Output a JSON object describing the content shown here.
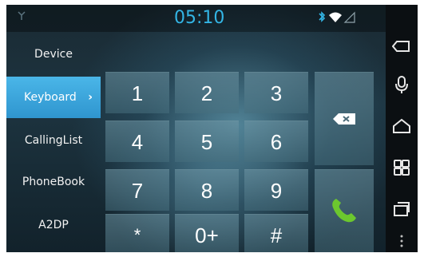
{
  "status_bar": {
    "time": "05:10",
    "icons": [
      "usb-debug-icon",
      "bluetooth-icon",
      "wifi-icon",
      "signal-icon"
    ]
  },
  "menu": {
    "items": [
      {
        "label": "Device",
        "active": false
      },
      {
        "label": "Keyboard",
        "active": true,
        "chevron": "›"
      },
      {
        "label": "CallingList",
        "active": false
      },
      {
        "label": "PhoneBook",
        "active": false
      },
      {
        "label": "A2DP",
        "active": false
      }
    ]
  },
  "keypad": {
    "keys": [
      "1",
      "2",
      "3",
      "4",
      "5",
      "6",
      "7",
      "8",
      "9",
      "*",
      "0+",
      "#"
    ],
    "delete_icon": "backspace-icon",
    "call_icon": "phone-call-icon"
  },
  "navbar": {
    "icons": [
      "back-icon",
      "microphone-icon",
      "home-icon",
      "apps-grid-icon",
      "recent-apps-icon",
      "menu-dots-icon"
    ]
  },
  "colors": {
    "accent": "#33b5e5",
    "active_tab": "#3aa6dd",
    "call_green": "#6cc72e"
  }
}
